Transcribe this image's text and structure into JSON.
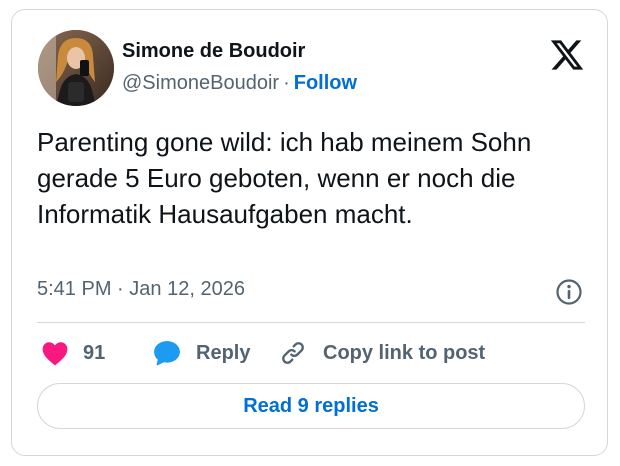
{
  "author": {
    "name": "Simone de Boudoir",
    "handle": "@SimoneBoudoir",
    "separator": "·",
    "follow_label": "Follow"
  },
  "tweet": {
    "text": "Parenting gone wild: ich hab meinem Sohn gerade 5 Euro geboten, wenn er noch die Informatik Hausaufgaben macht.",
    "time": "5:41 PM",
    "date_separator": "·",
    "date": "Jan 12, 2026"
  },
  "actions": {
    "like_count": "91",
    "reply_label": "Reply",
    "copy_label": "Copy link to post"
  },
  "read_replies_label": "Read 9 replies",
  "icons": {
    "logo": "x-logo-icon",
    "info": "info-icon",
    "like": "heart-icon",
    "reply": "speech-bubble-icon",
    "copy": "link-icon"
  },
  "colors": {
    "accent": "#006fd6",
    "like": "#f91880",
    "reply": "#1d9bf0",
    "muted": "#536471",
    "text": "#0f1419",
    "border": "#cfd9de"
  }
}
